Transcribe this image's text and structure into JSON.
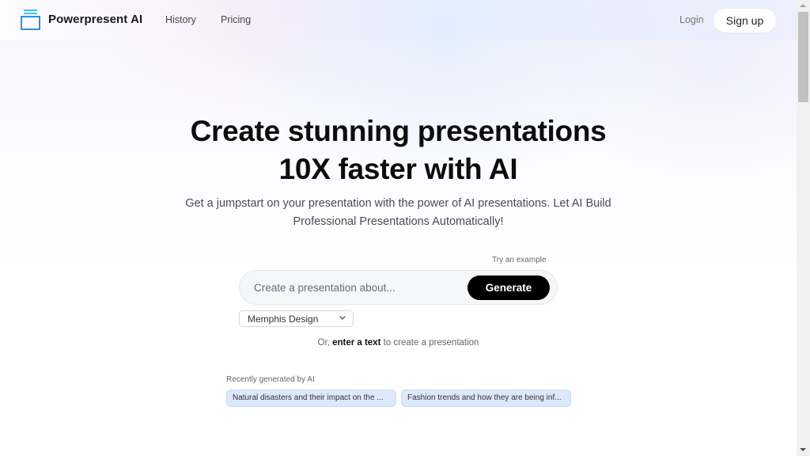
{
  "nav": {
    "brand": "Powerpresent AI",
    "logo_icon": "stacked-window-icon",
    "links": [
      {
        "label": "History"
      },
      {
        "label": "Pricing"
      }
    ],
    "login_label": "Login",
    "signup_label": "Sign up"
  },
  "hero": {
    "title_line1": "Create stunning presentations",
    "title_line2": "10X faster with AI",
    "subtitle": "Get a jumpstart on your presentation with the power of AI presentations. Let AI Build Professional Presentations Automatically!"
  },
  "prompt": {
    "try_example_label": "Try an example",
    "placeholder": "Create a presentation about...",
    "value": "",
    "generate_label": "Generate",
    "style_selected": "Memphis Design",
    "or_prefix": "Or,",
    "or_link": "enter a text",
    "or_suffix": "to create a presentation"
  },
  "recent": {
    "label": "Recently generated by AI",
    "items": [
      {
        "label": "Natural disasters and their impact on the ..."
      },
      {
        "label": "Fashion trends and how they are being inf..."
      }
    ]
  },
  "colors": {
    "logo_accent": "#2d8fe6",
    "logo_stripes": "#3ec6e8",
    "generate_bg": "#000000",
    "chip_bg": "#dde9fb"
  }
}
